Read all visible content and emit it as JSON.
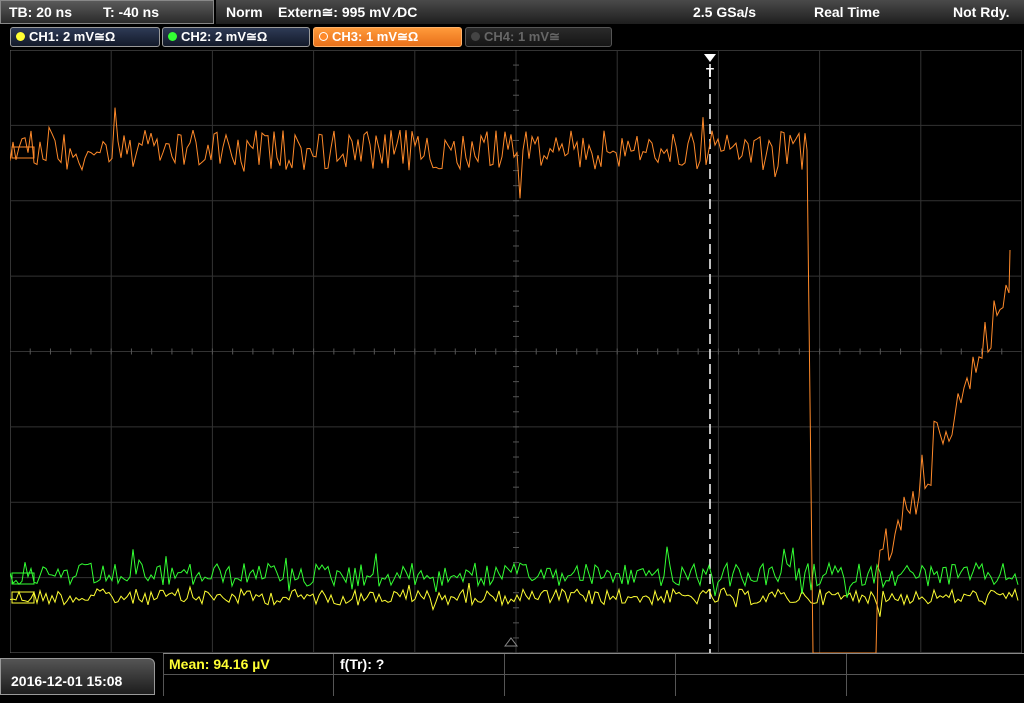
{
  "header": {
    "timebase": "TB: 20 ns",
    "trigger_offset": "T: -40 ns",
    "mode": "Norm",
    "trigger_source": "Extern≅: 995 mV ∕DC",
    "sample_rate": "2.5 GSa/s",
    "acq_mode": "Real Time",
    "status": "Not Rdy."
  },
  "channels": [
    {
      "label": "CH1: 2 mV≅Ω",
      "color": "#ffff33",
      "state": "on"
    },
    {
      "label": "CH2: 2 mV≅Ω",
      "color": "#33ff33",
      "state": "on"
    },
    {
      "label": "CH3: 1 mV≅Ω",
      "color": "#ff8a2a",
      "state": "active"
    },
    {
      "label": "CH4: 1 mV≅",
      "color": "#555555",
      "state": "off"
    }
  ],
  "trigger_marker": "T",
  "footer": {
    "datetime": "2016-12-01 15:08",
    "mean": "Mean: 94.16 µV",
    "ftr": "f(Tr): ?"
  },
  "colors": {
    "ch1": "#ffff33",
    "ch2": "#33ff33",
    "ch3": "#ff8a2a",
    "grid": "#3a3a3a",
    "trigger_line": "#ffffff"
  }
}
